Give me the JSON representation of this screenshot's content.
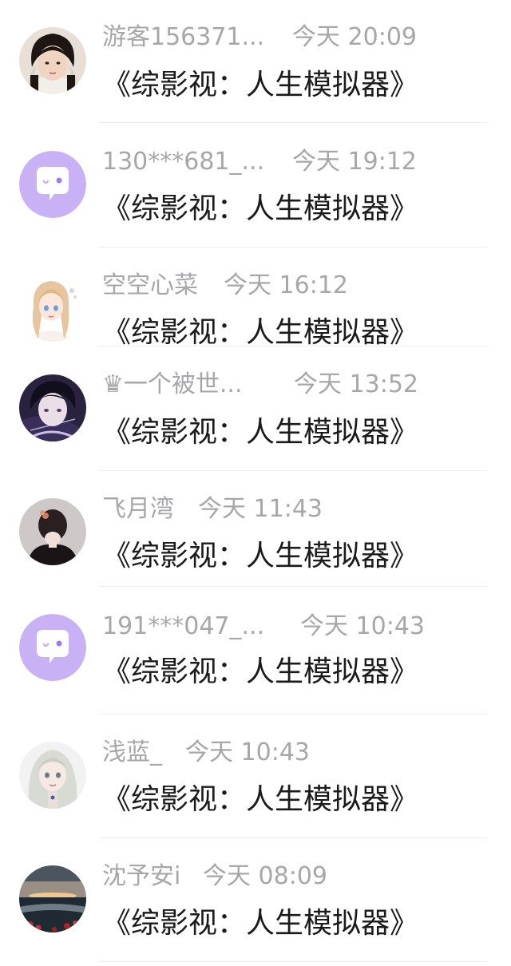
{
  "messages": [
    {
      "name": "游客156371...",
      "time": "今天 20:09",
      "text": "《综影视：人生模拟器》",
      "avatar": "girl-portrait-avatar"
    },
    {
      "name": "130***681_...",
      "time": "今天 19:12",
      "text": "《综影视：人生模拟器》",
      "avatar": "default-chat-bubble-avatar"
    },
    {
      "name": "空空心菜",
      "time": "今天 16:12",
      "text": "《综影视：人生模拟器》",
      "avatar": "anime-girl-avatar"
    },
    {
      "name": "♛一个被世...",
      "time": "今天 13:52",
      "text": "《综影视：人生模拟器》",
      "avatar": "anime-boy-avatar"
    },
    {
      "name": "飞月湾",
      "time": "今天 11:43",
      "text": "《综影视：人生模拟器》",
      "avatar": "woman-back-avatar"
    },
    {
      "name": "191***047_...",
      "time": "今天 10:43",
      "text": "《综影视：人生模拟器》",
      "avatar": "default-chat-bubble-avatar"
    },
    {
      "name": "浅蓝_",
      "time": "今天 10:43",
      "text": "《综影视：人生模拟器》",
      "avatar": "silver-hair-girl-avatar"
    },
    {
      "name": "沈予安i",
      "time": "今天 08:09",
      "text": "《综影视：人生模拟器》",
      "avatar": "sunset-landscape-avatar"
    }
  ],
  "colors": {
    "name_text": "#a7a7ab",
    "message_text": "#1b1b1b",
    "default_avatar_bg": "#c9b1f5",
    "divider": "#ededee"
  }
}
